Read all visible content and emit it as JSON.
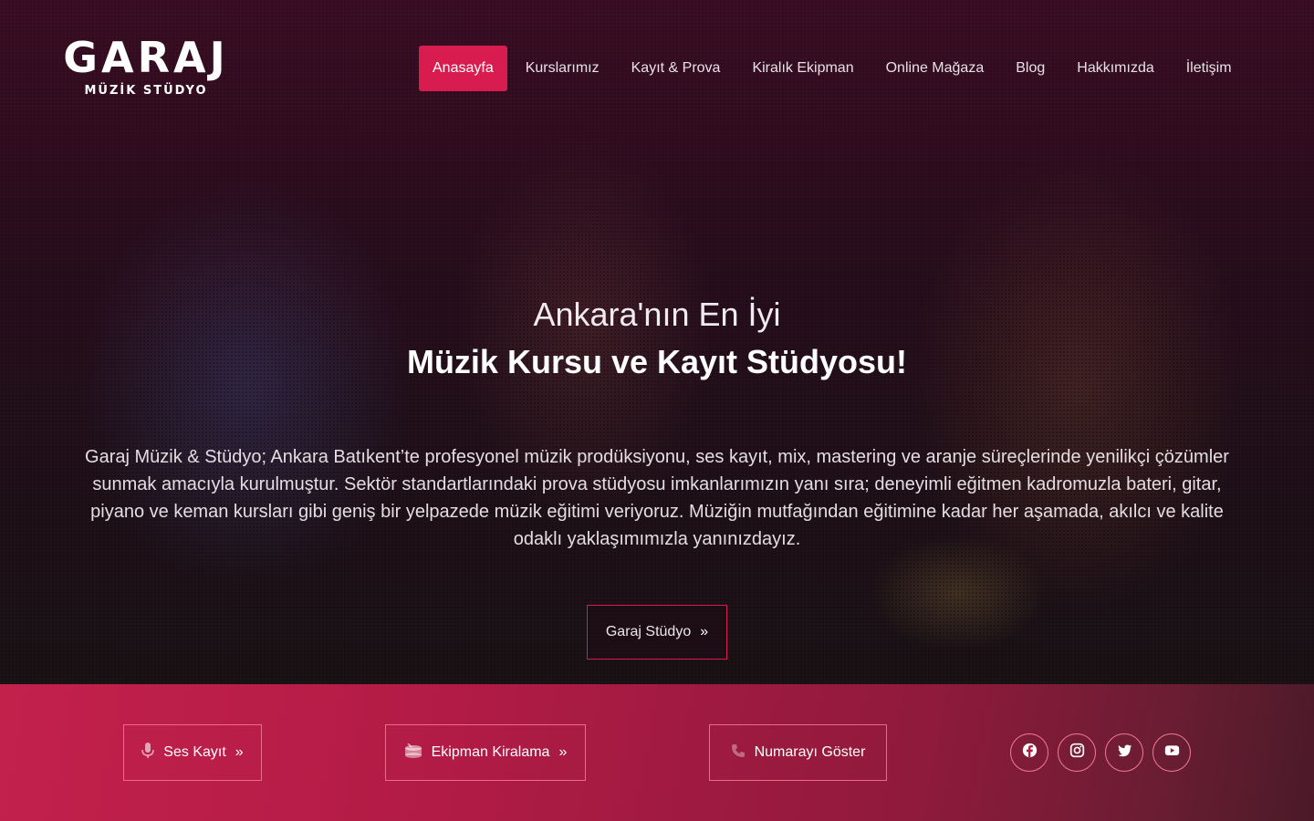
{
  "brand": {
    "name": "GARAJ",
    "tagline": "MÜZİK STÜDYO"
  },
  "nav": {
    "items": [
      {
        "label": "Anasayfa",
        "active": true
      },
      {
        "label": "Kurslarımız"
      },
      {
        "label": "Kayıt & Prova"
      },
      {
        "label": "Kiralık Ekipman"
      },
      {
        "label": "Online Mağaza"
      },
      {
        "label": "Blog"
      },
      {
        "label": "Hakkımızda"
      },
      {
        "label": "İletişim"
      }
    ]
  },
  "hero": {
    "title_line1": "Ankara'nın En İyi",
    "title_line2": "Müzik Kursu ve Kayıt Stüdyosu!",
    "description": "Garaj Müzik & Stüdyo; Ankara Batıkent’te profesyonel müzik prodüksiyonu, ses kayıt, mix, mastering ve aranje süreçlerinde yenilikçi çözümler sunmak amacıyla kurulmuştur. Sektör standartlarındaki prova stüdyosu imkanlarımızın yanı sıra; deneyimli eğitmen kadromuzla bateri, gitar, piyano ve keman kursları gibi geniş bir yelpazede müzik eğitimi veriyoruz. Müziğin mutfağından eğitimine kadar her aşamada, akılcı ve kalite odaklı yaklaşımımızla yanınızdayız.",
    "cta_label": "Garaj Stüdyo",
    "cta_icon": "chevron-double-right-icon"
  },
  "action_bar": {
    "buttons": [
      {
        "label": "Ses Kayıt",
        "icon": "microphone-icon"
      },
      {
        "label": "Ekipman Kiralama",
        "icon": "drum-icon"
      },
      {
        "label": "Numarayı Göster",
        "icon": "phone-icon"
      }
    ],
    "social": [
      "facebook-icon",
      "instagram-icon",
      "twitter-icon",
      "youtube-icon"
    ]
  },
  "colors": {
    "accent": "#d91c4f",
    "band_start": "#c2214c",
    "band_end": "#4a1a28"
  }
}
